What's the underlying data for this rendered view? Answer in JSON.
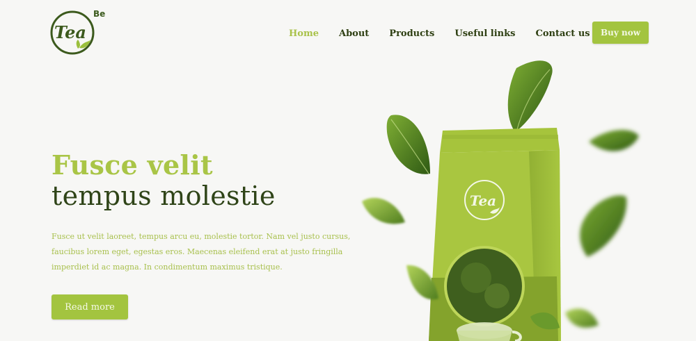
{
  "brand": {
    "logo_text": "Tea",
    "logo_super": "Be"
  },
  "nav": {
    "items": [
      {
        "label": "Home",
        "active": true
      },
      {
        "label": "About"
      },
      {
        "label": "Products"
      },
      {
        "label": "Useful links"
      },
      {
        "label": "Contact us"
      }
    ],
    "cta_label": "Buy now"
  },
  "hero": {
    "title_line1": "Fusce velit",
    "title_line2": "tempus molestie",
    "description": "Fusce ut velit laoreet, tempus arcu eu, molestie tortor. Nam vel justo cursus, faucibus lorem eget, egestas eros. Maecenas eleifend erat at justo fringilla imperdiet id ac magna. In condimentum maximus tristique.",
    "read_more_label": "Read more"
  },
  "illustration": {
    "package_logo_text": "Tea"
  },
  "colors": {
    "accent": "#a3c43f",
    "dark_green": "#2f4418",
    "light_green": "#a9c546",
    "background": "#f7f7f5"
  }
}
